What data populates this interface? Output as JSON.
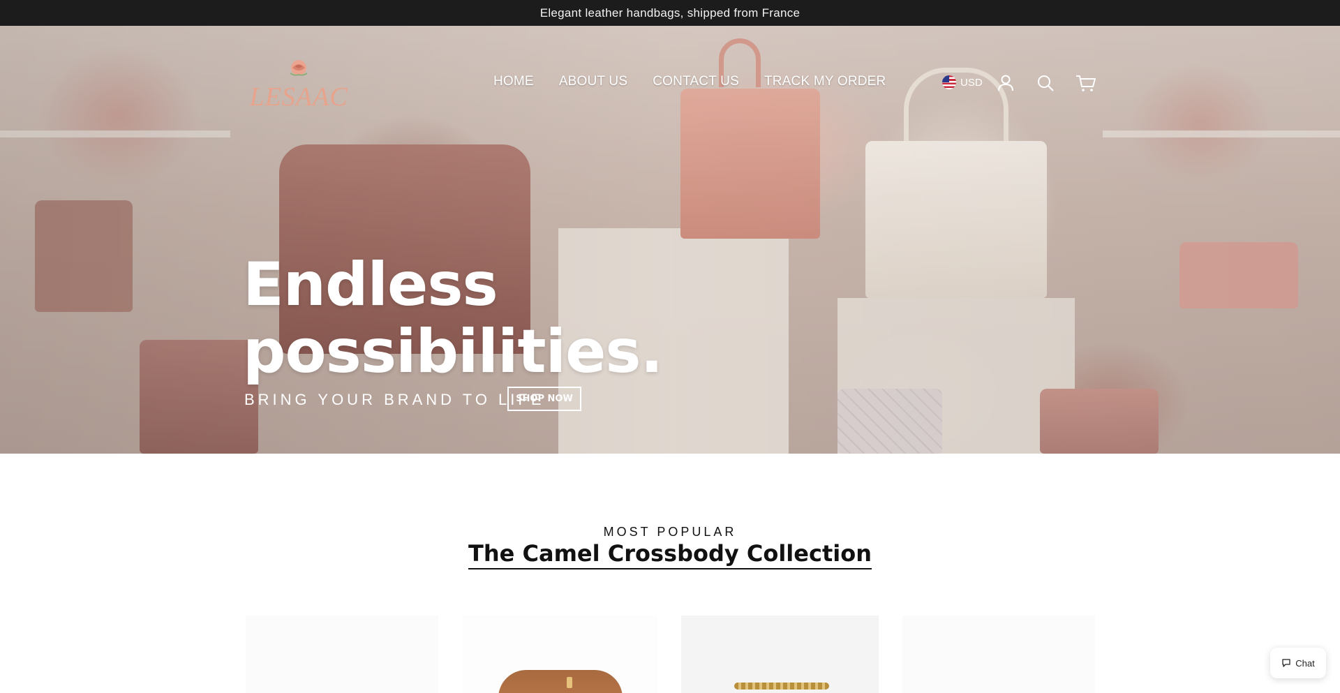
{
  "announcement": {
    "text": "Elegant leather handbags, shipped from France"
  },
  "header": {
    "logo_text": "LESAAC",
    "nav": [
      {
        "label": "HOME"
      },
      {
        "label": "ABOUT US"
      },
      {
        "label": "CONTACT US"
      },
      {
        "label": "TRACK MY ORDER"
      }
    ],
    "currency": "USD",
    "icons": [
      "us-flag-icon",
      "account-icon",
      "search-icon",
      "cart-icon"
    ]
  },
  "hero": {
    "title_line1": "Endless",
    "title_line2": "possibilities.",
    "subtitle": "BRING YOUR BRAND TO LIFE",
    "cta_label": "SHOP NOW"
  },
  "collection": {
    "eyebrow": "MOST POPULAR",
    "title": "The Camel Crossbody Collection"
  },
  "chat": {
    "label": "Chat",
    "icon": "chat-bubble-icon"
  },
  "colors": {
    "announcement_bg": "#1c1c1c",
    "logo_accent": "#e8a38c",
    "hero_text": "#ffffff"
  }
}
